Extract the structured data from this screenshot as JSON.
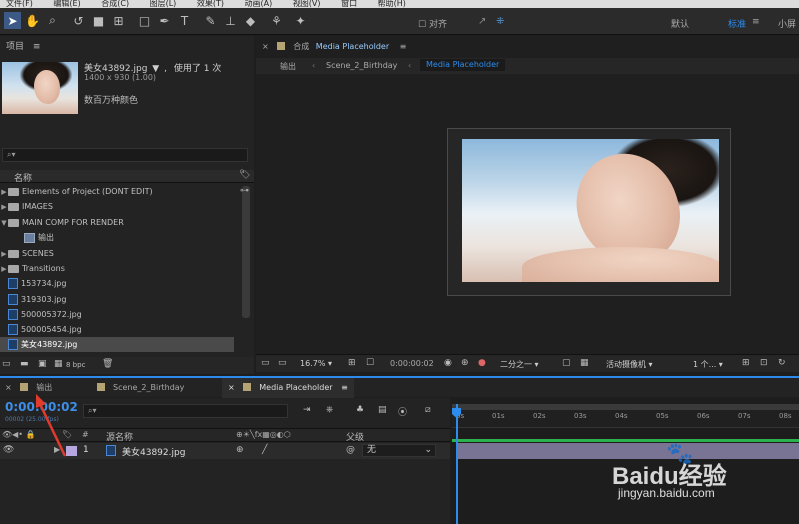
{
  "menubar": [
    "文件(F)",
    "编辑(E)",
    "合成(C)",
    "图层(L)",
    "效果(T)",
    "动画(A)",
    "视图(V)",
    "窗口",
    "帮助(H)"
  ],
  "toolbar": {
    "align_label": "对齐",
    "workspace_default": "默认",
    "workspace_standard": "标准",
    "workspace_small": "小屏",
    "icons": [
      "selection-tool-icon",
      "hand-tool-icon",
      "zoom-tool-icon",
      "rotate-tool-icon",
      "camera-tool-icon",
      "pan-behind-tool-icon",
      "rectangle-tool-icon",
      "pen-tool-icon",
      "text-tool-icon",
      "brush-tool-icon",
      "clone-stamp-tool-icon",
      "eraser-tool-icon",
      "roto-brush-tool-icon",
      "puppet-pin-tool-icon"
    ]
  },
  "project": {
    "title": "项目",
    "selected_name": "美女43892.jpg",
    "used_label": "使用了 1 次",
    "dimensions": "1400 x 930 (1.00)",
    "colors": "数百万种颜色",
    "search_placeholder": "",
    "col_name": "名称",
    "items": [
      {
        "type": "folder",
        "label": "Elements of Project (DONT EDIT)",
        "twirl": "▶"
      },
      {
        "type": "folder",
        "label": "IMAGES",
        "twirl": "▶"
      },
      {
        "type": "folder",
        "label": "MAIN COMP FOR RENDER",
        "twirl": "▼"
      },
      {
        "type": "comp",
        "label": "输出",
        "twirl": ""
      },
      {
        "type": "folder",
        "label": "SCENES",
        "twirl": "▶"
      },
      {
        "type": "folder",
        "label": "Transitions",
        "twirl": "▶"
      },
      {
        "type": "file",
        "label": "153734.jpg",
        "twirl": ""
      },
      {
        "type": "file",
        "label": "319303.jpg",
        "twirl": ""
      },
      {
        "type": "file",
        "label": "500005372.jpg",
        "twirl": ""
      },
      {
        "type": "file",
        "label": "500005454.jpg",
        "twirl": ""
      },
      {
        "type": "file",
        "label": "美女43892.jpg",
        "twirl": "",
        "selected": true
      }
    ],
    "bpc": "8 bpc"
  },
  "composition": {
    "panel_label": "合成",
    "comp_name": "Media Placeholder",
    "breadcrumbs": [
      "输出",
      "Scene_2_Birthday",
      "Media Placeholder"
    ],
    "zoom": "16.7%",
    "timecode": "0:00:00:02",
    "resolution": "二分之一",
    "camera": "活动摄像机",
    "views": "1 个..."
  },
  "timeline": {
    "tabs": [
      "输出",
      "Scene_2_Birthday",
      "Media Placeholder"
    ],
    "timecode": "0:00:00:02",
    "fps_note": "00002 (25.00 fps)",
    "search_placeholder": "",
    "col_layer_name": "源名称",
    "col_parent": "父级",
    "layer": {
      "number": "1",
      "name": "美女43892.jpg",
      "parent": "无"
    },
    "ruler": [
      "0s",
      "01s",
      "02s",
      "03s",
      "04s",
      "05s",
      "06s",
      "07s",
      "08s"
    ]
  },
  "watermark": {
    "brand": "Baidu经验",
    "url": "jingyan.baidu.com"
  },
  "colors": {
    "accent": "#2d8ceb",
    "label_purple": "#b7a7e0",
    "selection": "#3d5a86"
  }
}
